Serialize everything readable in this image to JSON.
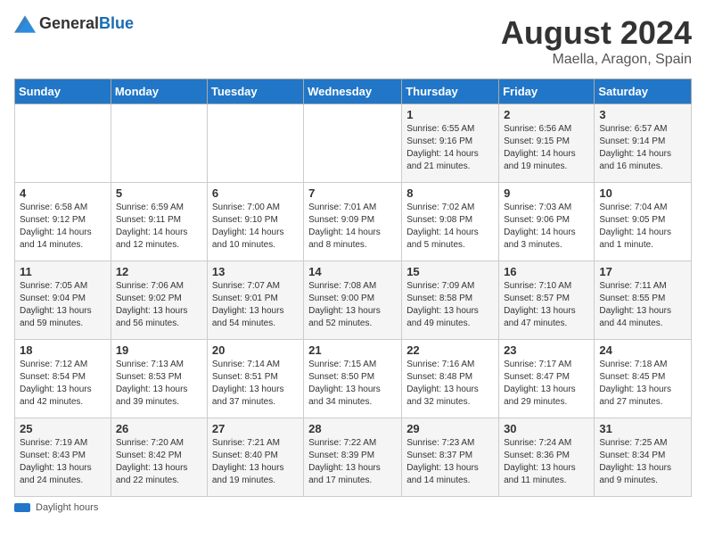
{
  "header": {
    "logo_general": "General",
    "logo_blue": "Blue",
    "month_year": "August 2024",
    "location": "Maella, Aragon, Spain"
  },
  "weekdays": [
    "Sunday",
    "Monday",
    "Tuesday",
    "Wednesday",
    "Thursday",
    "Friday",
    "Saturday"
  ],
  "footer": {
    "label": "Daylight hours"
  },
  "weeks": [
    [
      {
        "day": "",
        "info": ""
      },
      {
        "day": "",
        "info": ""
      },
      {
        "day": "",
        "info": ""
      },
      {
        "day": "",
        "info": ""
      },
      {
        "day": "1",
        "info": "Sunrise: 6:55 AM\nSunset: 9:16 PM\nDaylight: 14 hours\nand 21 minutes."
      },
      {
        "day": "2",
        "info": "Sunrise: 6:56 AM\nSunset: 9:15 PM\nDaylight: 14 hours\nand 19 minutes."
      },
      {
        "day": "3",
        "info": "Sunrise: 6:57 AM\nSunset: 9:14 PM\nDaylight: 14 hours\nand 16 minutes."
      }
    ],
    [
      {
        "day": "4",
        "info": "Sunrise: 6:58 AM\nSunset: 9:12 PM\nDaylight: 14 hours\nand 14 minutes."
      },
      {
        "day": "5",
        "info": "Sunrise: 6:59 AM\nSunset: 9:11 PM\nDaylight: 14 hours\nand 12 minutes."
      },
      {
        "day": "6",
        "info": "Sunrise: 7:00 AM\nSunset: 9:10 PM\nDaylight: 14 hours\nand 10 minutes."
      },
      {
        "day": "7",
        "info": "Sunrise: 7:01 AM\nSunset: 9:09 PM\nDaylight: 14 hours\nand 8 minutes."
      },
      {
        "day": "8",
        "info": "Sunrise: 7:02 AM\nSunset: 9:08 PM\nDaylight: 14 hours\nand 5 minutes."
      },
      {
        "day": "9",
        "info": "Sunrise: 7:03 AM\nSunset: 9:06 PM\nDaylight: 14 hours\nand 3 minutes."
      },
      {
        "day": "10",
        "info": "Sunrise: 7:04 AM\nSunset: 9:05 PM\nDaylight: 14 hours\nand 1 minute."
      }
    ],
    [
      {
        "day": "11",
        "info": "Sunrise: 7:05 AM\nSunset: 9:04 PM\nDaylight: 13 hours\nand 59 minutes."
      },
      {
        "day": "12",
        "info": "Sunrise: 7:06 AM\nSunset: 9:02 PM\nDaylight: 13 hours\nand 56 minutes."
      },
      {
        "day": "13",
        "info": "Sunrise: 7:07 AM\nSunset: 9:01 PM\nDaylight: 13 hours\nand 54 minutes."
      },
      {
        "day": "14",
        "info": "Sunrise: 7:08 AM\nSunset: 9:00 PM\nDaylight: 13 hours\nand 52 minutes."
      },
      {
        "day": "15",
        "info": "Sunrise: 7:09 AM\nSunset: 8:58 PM\nDaylight: 13 hours\nand 49 minutes."
      },
      {
        "day": "16",
        "info": "Sunrise: 7:10 AM\nSunset: 8:57 PM\nDaylight: 13 hours\nand 47 minutes."
      },
      {
        "day": "17",
        "info": "Sunrise: 7:11 AM\nSunset: 8:55 PM\nDaylight: 13 hours\nand 44 minutes."
      }
    ],
    [
      {
        "day": "18",
        "info": "Sunrise: 7:12 AM\nSunset: 8:54 PM\nDaylight: 13 hours\nand 42 minutes."
      },
      {
        "day": "19",
        "info": "Sunrise: 7:13 AM\nSunset: 8:53 PM\nDaylight: 13 hours\nand 39 minutes."
      },
      {
        "day": "20",
        "info": "Sunrise: 7:14 AM\nSunset: 8:51 PM\nDaylight: 13 hours\nand 37 minutes."
      },
      {
        "day": "21",
        "info": "Sunrise: 7:15 AM\nSunset: 8:50 PM\nDaylight: 13 hours\nand 34 minutes."
      },
      {
        "day": "22",
        "info": "Sunrise: 7:16 AM\nSunset: 8:48 PM\nDaylight: 13 hours\nand 32 minutes."
      },
      {
        "day": "23",
        "info": "Sunrise: 7:17 AM\nSunset: 8:47 PM\nDaylight: 13 hours\nand 29 minutes."
      },
      {
        "day": "24",
        "info": "Sunrise: 7:18 AM\nSunset: 8:45 PM\nDaylight: 13 hours\nand 27 minutes."
      }
    ],
    [
      {
        "day": "25",
        "info": "Sunrise: 7:19 AM\nSunset: 8:43 PM\nDaylight: 13 hours\nand 24 minutes."
      },
      {
        "day": "26",
        "info": "Sunrise: 7:20 AM\nSunset: 8:42 PM\nDaylight: 13 hours\nand 22 minutes."
      },
      {
        "day": "27",
        "info": "Sunrise: 7:21 AM\nSunset: 8:40 PM\nDaylight: 13 hours\nand 19 minutes."
      },
      {
        "day": "28",
        "info": "Sunrise: 7:22 AM\nSunset: 8:39 PM\nDaylight: 13 hours\nand 17 minutes."
      },
      {
        "day": "29",
        "info": "Sunrise: 7:23 AM\nSunset: 8:37 PM\nDaylight: 13 hours\nand 14 minutes."
      },
      {
        "day": "30",
        "info": "Sunrise: 7:24 AM\nSunset: 8:36 PM\nDaylight: 13 hours\nand 11 minutes."
      },
      {
        "day": "31",
        "info": "Sunrise: 7:25 AM\nSunset: 8:34 PM\nDaylight: 13 hours\nand 9 minutes."
      }
    ]
  ]
}
